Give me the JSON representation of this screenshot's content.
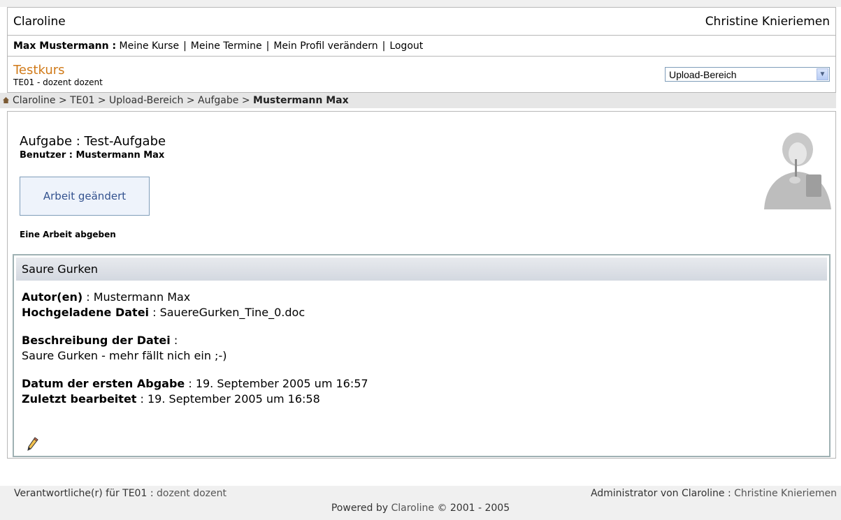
{
  "header": {
    "site_title": "Claroline",
    "admin_name": "Christine Knieriemen"
  },
  "userbar": {
    "user": "Max Mustermann :",
    "links": [
      "Meine Kurse",
      "Meine Termine",
      "Mein Profil verändern",
      "Logout"
    ],
    "separator": "|"
  },
  "course": {
    "title": "Testkurs",
    "subtitle": "TE01 - dozent dozent",
    "tool_select_value": "Upload-Bereich"
  },
  "breadcrumb": {
    "items": [
      "Claroline",
      "TE01",
      "Upload-Bereich",
      "Aufgabe"
    ],
    "separator": ">",
    "current": "Mustermann Max"
  },
  "task": {
    "title": "Aufgabe : Test-Aufgabe",
    "user_label": "Benutzer :",
    "user_value": "Mustermann Max",
    "edit_button": "Arbeit geändert",
    "submit_label": "Eine Arbeit abgeben"
  },
  "submission": {
    "title": "Saure Gurken",
    "author_label": "Autor(en)",
    "author_value": " : Mustermann Max",
    "file_label": "Hochgeladene Datei",
    "file_value": " : SauereGurken_Tine_0.doc",
    "desc_label": "Beschreibung der Datei",
    "desc_colon": " :",
    "desc_value": "Saure Gurken - mehr fällt nich ein ;-)",
    "first_date_label": "Datum der ersten Abgabe",
    "first_date_value": " : 19. September 2005 um 16:57",
    "last_edit_label": "Zuletzt bearbeitet",
    "last_edit_value": " : 19. September 2005 um 16:58"
  },
  "footer": {
    "responsible_label": "Verantwortliche(r) für TE01 :",
    "responsible_value": "dozent dozent",
    "admin_label": "Administrator von Claroline :",
    "admin_value": "Christine Knieriemen",
    "powered_prefix": "Powered by",
    "powered_link": "Claroline",
    "powered_suffix": "© 2001 - 2005"
  },
  "icons": {
    "home": "home-icon",
    "edit": "pencil-icon",
    "dropdown": "chevron-down-icon"
  },
  "colors": {
    "course_title": "#d07a19",
    "button_text": "#33528f"
  }
}
